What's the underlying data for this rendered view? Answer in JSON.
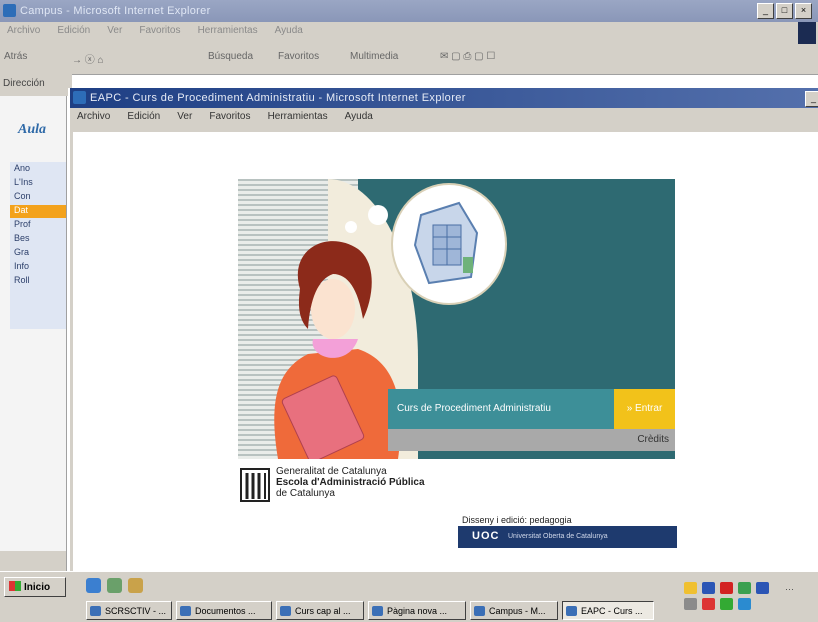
{
  "outer_window": {
    "title": "Campus - Microsoft Internet Explorer",
    "menu": [
      "Archivo",
      "Edición",
      "Ver",
      "Favoritos",
      "Herramientas",
      "Ayuda"
    ],
    "toolbar": {
      "back": "Atrás",
      "search": "Búsqueda",
      "favorites": "Favoritos",
      "multimedia": "Multimedia"
    },
    "address_label": "Dirección",
    "logo_text": "Aula",
    "sidebar_items": [
      "Ano",
      "L'Ins",
      "Con",
      "Dat",
      "Prof",
      "Bes",
      "Gra",
      "Info",
      "Roll"
    ],
    "selected_index": 3
  },
  "inner_window": {
    "title": "EAPC - Curs de Procediment Administratiu - Microsoft Internet Explorer",
    "menu": [
      "Archivo",
      "Edición",
      "Ver",
      "Favoritos",
      "Herramientas",
      "Ayuda"
    ]
  },
  "page": {
    "course_title": "Curs de Procediment Administratiu",
    "enter_label": "» Entrar",
    "credits_label": "Crèdits",
    "gen_line1": "Generalitat de Catalunya",
    "gen_line2": "Escola d'Administració Pública",
    "gen_line3": "de Catalunya",
    "design_label": "Disseny i edició: pedagogia",
    "uoc_brand": "UOC",
    "uoc_subtitle": "Universitat Oberta de Catalunya"
  },
  "taskbar": {
    "start_label": "Inicio",
    "tasks": [
      "SCRSCTIV - ...",
      "Documentos ...",
      "Curs cap al ...",
      "Pàgina nova ...",
      "Campus - M...",
      "EAPC - Curs ..."
    ],
    "active_task": 5
  },
  "colors": {
    "banner_teal": "#2e6a72",
    "enter_yellow": "#f2c21a",
    "uoc_navy": "#1e3a6e",
    "selected_orange": "#f3a21c"
  }
}
